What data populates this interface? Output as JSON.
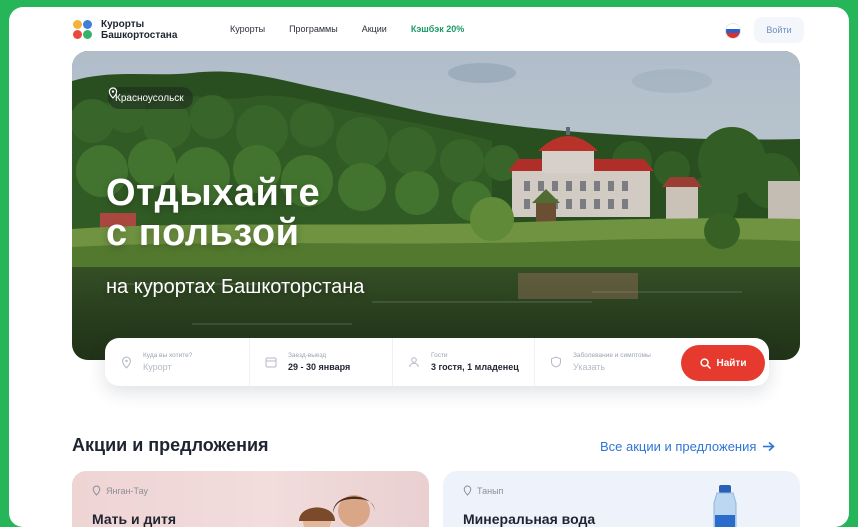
{
  "brand": {
    "line1": "Курорты",
    "line2": "Башкортостана",
    "colors": [
      "#f3b23a",
      "#3d7fd9",
      "#e84a3c",
      "#36b26b"
    ]
  },
  "nav": {
    "items": [
      "Курорты",
      "Программы",
      "Акции"
    ],
    "cashback": "Кэшбэк 20%"
  },
  "header": {
    "language_flag": "russian-flag",
    "login_label": "Войти"
  },
  "hero": {
    "location": "Красноусольск",
    "title_line1": "Отдыхайте",
    "title_line2": "с пользой",
    "subtitle": "на курортах Башкоторстана"
  },
  "search": {
    "where": {
      "label": "Куда вы хотите?",
      "placeholder": "Курорт"
    },
    "dates": {
      "label": "Заезд-выезд",
      "value": "29 - 30 января"
    },
    "guests": {
      "label": "Гости",
      "value": "3 гостя, 1 младенец"
    },
    "symptoms": {
      "label": "Заболевание и симптомы",
      "placeholder": "Указать"
    },
    "find_label": "Найти"
  },
  "promotions": {
    "title": "Акции и предложения",
    "all_link": "Все акции и предложения",
    "cards": [
      {
        "location": "Янган-Тау",
        "title": "Мать и дитя"
      },
      {
        "location": "Танып",
        "title": "Минеральная вода"
      }
    ]
  },
  "colors": {
    "frame_bg": "#27b55a",
    "accent_red": "#e63a2e",
    "link_blue": "#2f75d6",
    "cashback_green": "#1a9a64"
  }
}
